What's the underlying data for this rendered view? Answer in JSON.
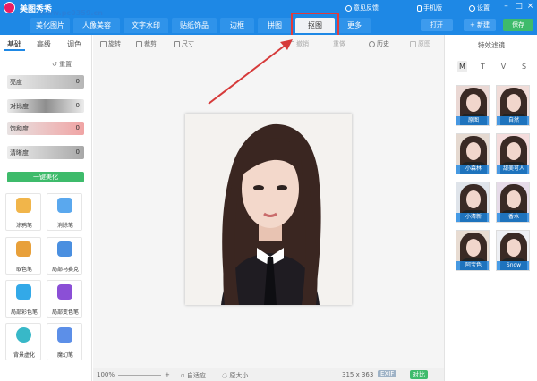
{
  "app": {
    "title": "美图秀秀"
  },
  "titlebar": {
    "feedback": "意见反馈",
    "mobile": "手机版",
    "settings": "设置"
  },
  "nav": {
    "tabs": [
      "美化图片",
      "人像美容",
      "文字水印",
      "贴纸饰品",
      "边框",
      "拼图",
      "抠图",
      "更多"
    ],
    "active": "抠图",
    "open": "打开",
    "new": "+ 新建",
    "save": "保存"
  },
  "watermark": "www.pc0359.cn",
  "left": {
    "tabs": [
      "基础",
      "高级",
      "调色"
    ],
    "reset": "重置",
    "sliders": [
      {
        "label": "亮度",
        "value": "0"
      },
      {
        "label": "对比度",
        "value": "0"
      },
      {
        "label": "饱和度",
        "value": "0"
      },
      {
        "label": "清晰度",
        "value": "0"
      }
    ],
    "beautify": "一键美化",
    "tools": [
      "涂鸦笔",
      "消除笔",
      "取色笔",
      "局部马赛克",
      "局部彩色笔",
      "局部变色笔",
      "背景虚化",
      "魔幻笔"
    ]
  },
  "toolbar": {
    "rotate": "旋转",
    "crop": "裁剪",
    "size": "尺寸",
    "undo": "撤销",
    "redo": "重做",
    "history": "历史",
    "compare": "原图"
  },
  "status": {
    "zoom": "100%",
    "fit": "自适应",
    "actual": "原大小",
    "dims": "315 x 363",
    "exif": "EXIF",
    "compare": "对比"
  },
  "filters": {
    "heading": "特效滤镜",
    "tabs": [
      "M",
      "T",
      "V",
      "S"
    ],
    "items": [
      "原图",
      "自然",
      "小森林",
      "甜美可人",
      "小清新",
      "香水",
      "阿宝色",
      "Snow"
    ]
  }
}
